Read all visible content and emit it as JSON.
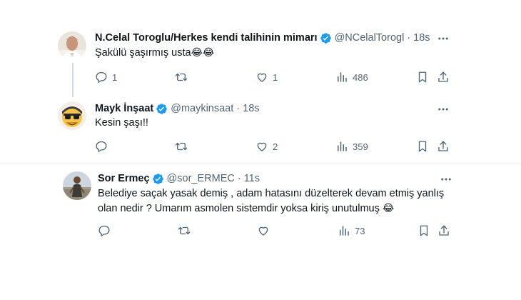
{
  "tweets": [
    {
      "display_name": "N.Celal Toroglu/Herkes kendi talihinin mimarı",
      "handle": "@NCelalTorogl",
      "separator": "·",
      "time": "18s",
      "text": "Şakülü şaşırmış usta",
      "emoji": "😂😂",
      "replies": "1",
      "retweets": "",
      "likes": "1",
      "views": "486"
    },
    {
      "display_name": "Mayk İnşaat",
      "handle": "@maykinsaat",
      "separator": "·",
      "time": "18s",
      "text": "Kesin şaşı!!",
      "emoji": "",
      "replies": "",
      "retweets": "",
      "likes": "2",
      "views": "359"
    },
    {
      "display_name": "Sor Ermeç",
      "handle": "@sor_ERMEC",
      "separator": "·",
      "time": "11s",
      "text_line1": "Belediye saçak yasak demiş , adam hatasını düzelterek devam etmiş yanlış",
      "text_line2": "olan nedir ? Umarım asmolen sistemdir yoksa kiriş unutulmuş",
      "emoji": "😂",
      "replies": "",
      "retweets": "",
      "likes": "",
      "views": "73"
    }
  ],
  "icons": {
    "verified_color": "#1d9bf0",
    "reply": "reply-icon",
    "retweet": "retweet-icon",
    "like": "heart-icon",
    "views": "views-icon",
    "bookmark": "bookmark-icon",
    "share": "share-icon",
    "more": "more-icon"
  }
}
